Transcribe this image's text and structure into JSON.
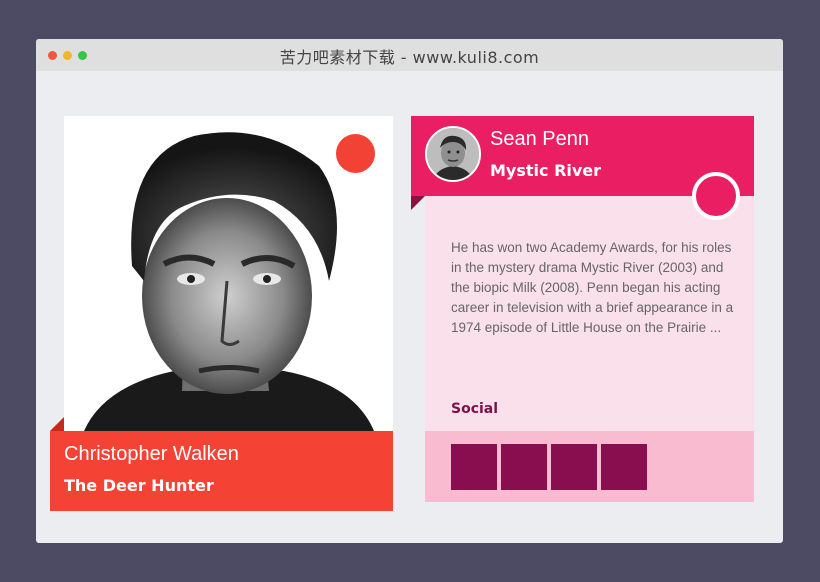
{
  "window": {
    "title": "苦力吧素材下载 - www.kuli8.com"
  },
  "cards": [
    {
      "name": "Christopher Walken",
      "film": "The Deer Hunter",
      "accent": "#f44335"
    },
    {
      "name": "Sean Penn",
      "film": "Mystic River",
      "accent": "#e91e63",
      "bio": "He has won two Academy Awards, for his roles in the mystery drama Mystic River (2003) and the biopic Milk (2008). Penn began his acting career in television with a brief appearance in a 1974 episode of Little House on the Prairie ...",
      "social_label": "Social",
      "social_buttons": 4
    }
  ],
  "colors": {
    "background": "#4d4a63",
    "social_button": "#880e4f",
    "body_bg": "#fae0ea"
  }
}
